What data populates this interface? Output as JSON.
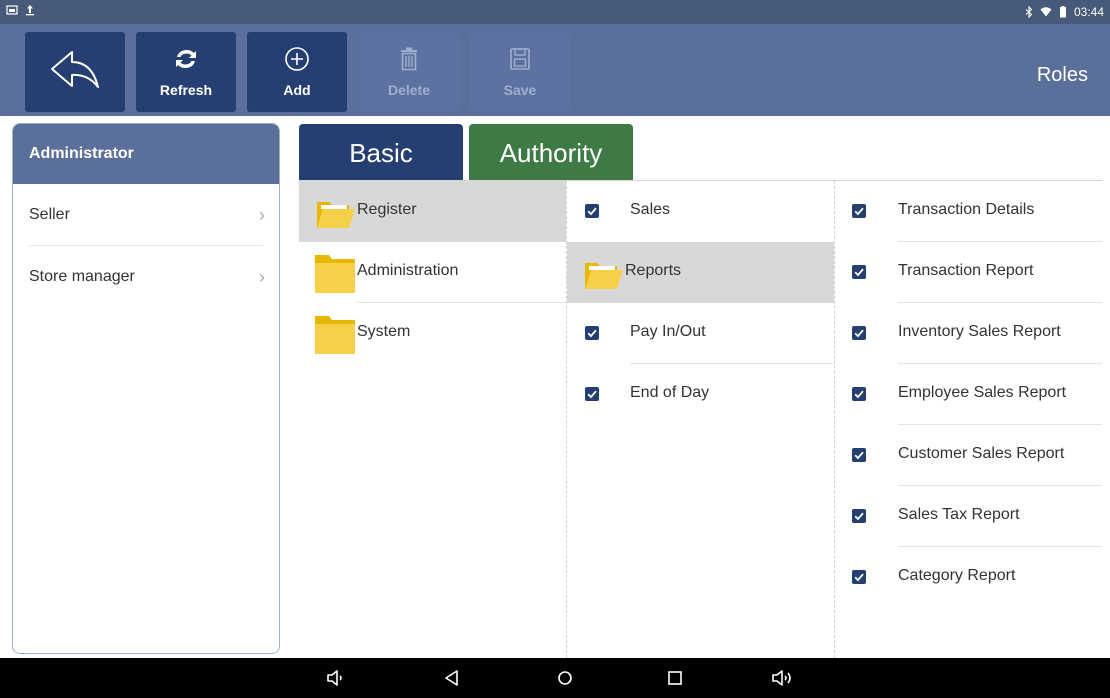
{
  "status_bar": {
    "time": "03:44"
  },
  "toolbar": {
    "back_icon": "back-arrow-icon",
    "refresh_label": "Refresh",
    "add_label": "Add",
    "delete_label": "Delete",
    "save_label": "Save",
    "title": "Roles"
  },
  "roles": [
    {
      "label": "Administrator",
      "selected": true
    },
    {
      "label": "Seller",
      "selected": false
    },
    {
      "label": "Store manager",
      "selected": false
    }
  ],
  "tabs": {
    "basic": "Basic",
    "authority": "Authority"
  },
  "categories": [
    {
      "label": "Register",
      "selected": true,
      "open": true
    },
    {
      "label": "Administration",
      "selected": false,
      "open": false
    },
    {
      "label": "System",
      "selected": false,
      "open": false
    }
  ],
  "register_items": [
    {
      "label": "Sales",
      "type": "check",
      "checked": true
    },
    {
      "label": "Reports",
      "type": "folder",
      "selected": true
    },
    {
      "label": "Pay In/Out",
      "type": "check",
      "checked": true
    },
    {
      "label": "End of Day",
      "type": "check",
      "checked": true
    }
  ],
  "report_items": [
    {
      "label": "Transaction Details",
      "checked": true
    },
    {
      "label": "Transaction Report",
      "checked": true
    },
    {
      "label": "Inventory Sales Report",
      "checked": true
    },
    {
      "label": "Employee Sales Report",
      "checked": true
    },
    {
      "label": "Customer Sales Report",
      "checked": true
    },
    {
      "label": "Sales Tax Report",
      "checked": true
    },
    {
      "label": "Category Report",
      "checked": true
    }
  ],
  "colors": {
    "accent_dark": "#263f73",
    "toolbar": "#5a6f9a",
    "authority_tab": "#3e7a45",
    "folder": "#f5c518"
  }
}
